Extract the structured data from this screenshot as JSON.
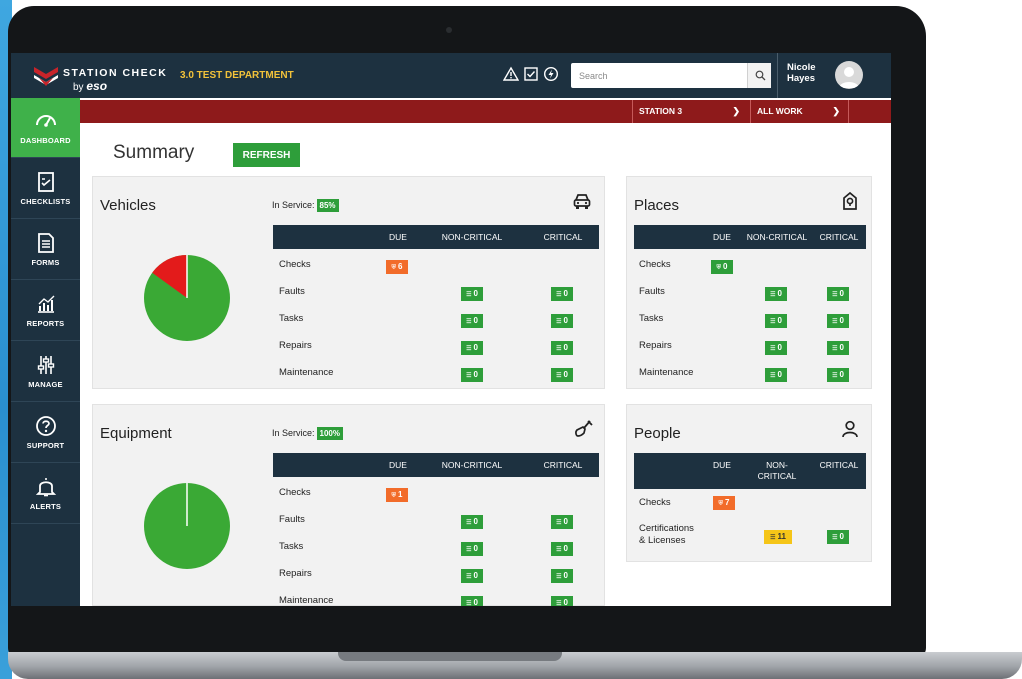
{
  "app": {
    "brand_title": "STATION CHECK",
    "brand_by": "by",
    "brand_eso": "eso",
    "department": "3.0 TEST DEPARTMENT"
  },
  "header": {
    "search_placeholder": "Search",
    "user_first": "Nicole",
    "user_last": "Hayes",
    "icons": [
      "warning-icon",
      "checkbox-icon",
      "bolt-icon",
      "search-icon",
      "avatar-icon"
    ]
  },
  "station_bar": {
    "station": "STATION 3",
    "work": "ALL WORK"
  },
  "sidebar": {
    "items": [
      {
        "label": "DASHBOARD",
        "icon": "gauge-icon"
      },
      {
        "label": "CHECKLISTS",
        "icon": "checklist-icon"
      },
      {
        "label": "FORMS",
        "icon": "form-icon"
      },
      {
        "label": "REPORTS",
        "icon": "chart-icon"
      },
      {
        "label": "MANAGE",
        "icon": "sliders-icon"
      },
      {
        "label": "SUPPORT",
        "icon": "help-icon"
      },
      {
        "label": "ALERTS",
        "icon": "bell-icon"
      }
    ]
  },
  "summary": {
    "title": "Summary",
    "refresh_label": "REFRESH"
  },
  "columns": {
    "due": "DUE",
    "non_critical": "NON-CRITICAL",
    "critical": "CRITICAL",
    "non_critical_wrapped_1": "NON-",
    "non_critical_wrapped_2": "CRITICAL"
  },
  "vehicles": {
    "title": "Vehicles",
    "in_service_label": "In Service:",
    "in_service_value": "85%",
    "in_service_fraction": 0.85,
    "icon": "car-icon",
    "rows": [
      {
        "label": "Checks",
        "due": "6"
      },
      {
        "label": "Faults",
        "non_critical": "0",
        "critical": "0"
      },
      {
        "label": "Tasks",
        "non_critical": "0",
        "critical": "0"
      },
      {
        "label": "Repairs",
        "non_critical": "0",
        "critical": "0"
      },
      {
        "label": "Maintenance",
        "non_critical": "0",
        "critical": "0"
      }
    ]
  },
  "equipment": {
    "title": "Equipment",
    "in_service_label": "In Service:",
    "in_service_value": "100%",
    "in_service_fraction": 1.0,
    "icon": "shovel-icon",
    "rows": [
      {
        "label": "Checks",
        "due": "1"
      },
      {
        "label": "Faults",
        "non_critical": "0",
        "critical": "0"
      },
      {
        "label": "Tasks",
        "non_critical": "0",
        "critical": "0"
      },
      {
        "label": "Repairs",
        "non_critical": "0",
        "critical": "0"
      },
      {
        "label": "Maintenance",
        "non_critical": "0",
        "critical": "0"
      }
    ]
  },
  "places": {
    "title": "Places",
    "icon": "map-pin-icon",
    "rows": [
      {
        "label": "Checks",
        "due": "0"
      },
      {
        "label": "Faults",
        "non_critical": "0",
        "critical": "0"
      },
      {
        "label": "Tasks",
        "non_critical": "0",
        "critical": "0"
      },
      {
        "label": "Repairs",
        "non_critical": "0",
        "critical": "0"
      },
      {
        "label": "Maintenance",
        "non_critical": "0",
        "critical": "0"
      }
    ]
  },
  "people": {
    "title": "People",
    "icon": "person-icon",
    "rows": [
      {
        "label": "Checks",
        "due": "7"
      },
      {
        "label_1": "Certifications",
        "label_2": "& Licenses",
        "non_critical": "11",
        "critical": "0"
      }
    ]
  },
  "colors": {
    "navy": "#1d3140",
    "green": "#2e9e3a",
    "active_green": "#3fb14a",
    "red_bar": "#8e1a1b",
    "orange": "#f26c2a",
    "yellow": "#f5c518",
    "dept_gold": "#f2c23a",
    "pie_green": "#3aa935",
    "pie_red": "#e31b1b"
  }
}
